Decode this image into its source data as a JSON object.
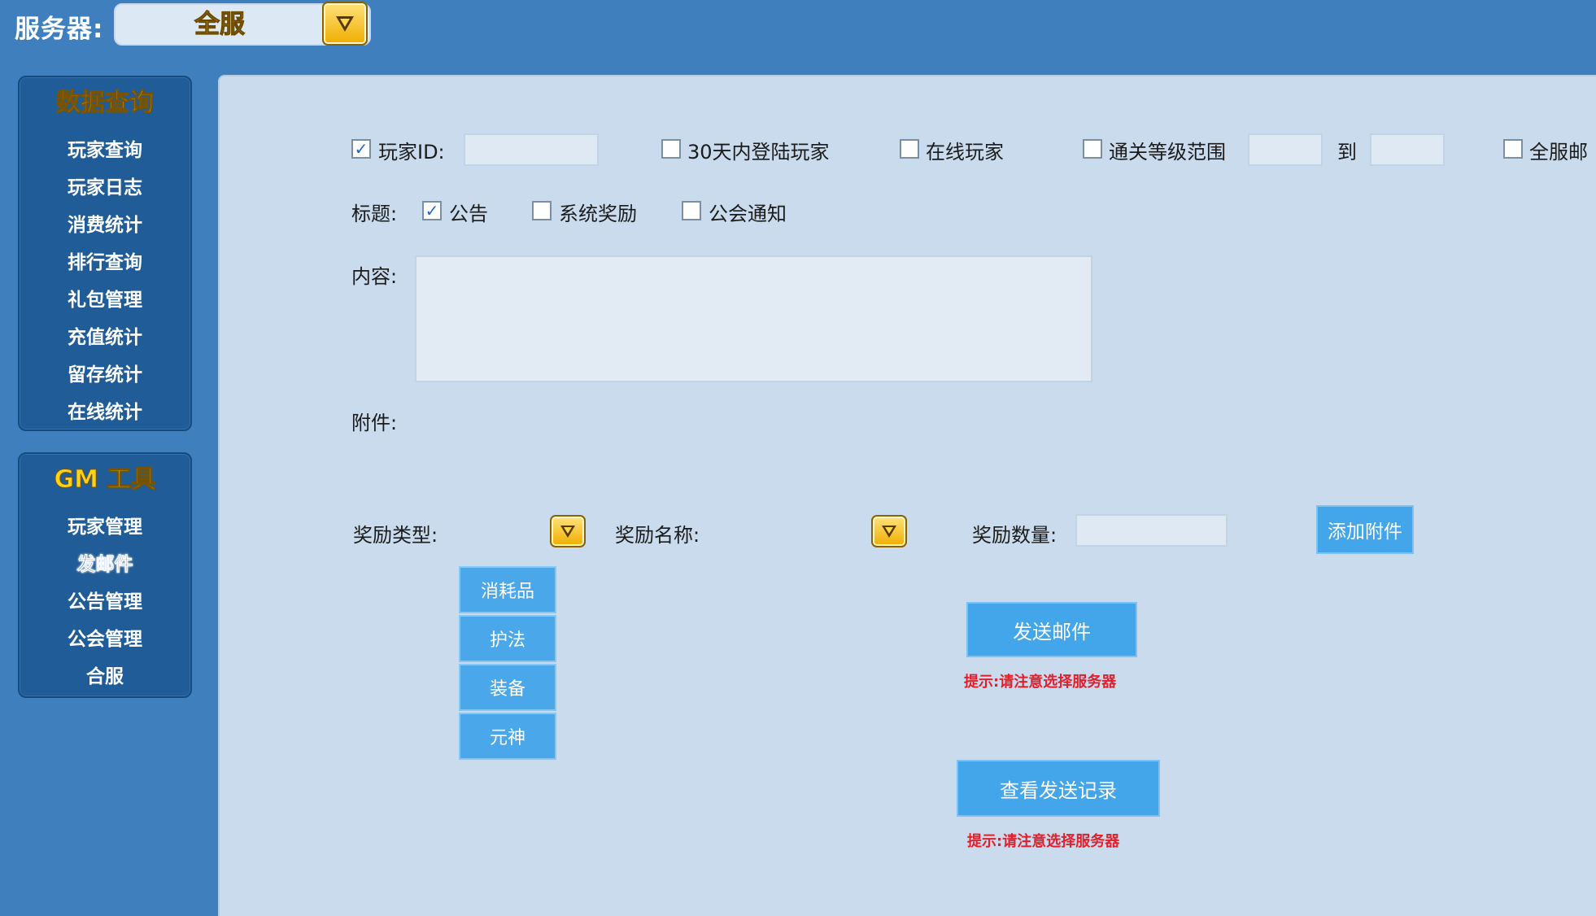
{
  "header": {
    "server_label": "服务器:",
    "server_value": "全服"
  },
  "sidebar": {
    "query_title": "数据查询",
    "query_items": [
      "玩家查询",
      "玩家日志",
      "消费统计",
      "排行查询",
      "礼包管理",
      "充值统计",
      "留存统计",
      "在线统计"
    ],
    "gm_title": "GM 工具",
    "gm_items": [
      "玩家管理",
      "发邮件",
      "公告管理",
      "公会管理",
      "合服"
    ],
    "active_item": "发邮件"
  },
  "filters": {
    "player_id_label": "玩家ID:",
    "player_id_checked": true,
    "login30_label": "30天内登陆玩家",
    "login30_checked": false,
    "online_label": "在线玩家",
    "online_checked": false,
    "level_range_label": "通关等级范围",
    "level_range_checked": false,
    "to_label": "到",
    "all_server_label": "全服邮",
    "all_server_checked": false
  },
  "title_row": {
    "label": "标题:",
    "options": [
      {
        "label": "公告",
        "checked": true
      },
      {
        "label": "系统奖励",
        "checked": false
      },
      {
        "label": "公会通知",
        "checked": false
      }
    ]
  },
  "content": {
    "label": "内容:",
    "value": ""
  },
  "attachment": {
    "label": "附件:",
    "reward_type_label": "奖励类型:",
    "reward_name_label": "奖励名称:",
    "reward_qty_label": "奖励数量:",
    "add_button": "添加附件",
    "type_options": [
      "消耗品",
      "护法",
      "装备",
      "元神"
    ]
  },
  "actions": {
    "send_button": "发送邮件",
    "send_hint": "提示:请注意选择服务器",
    "history_button": "查看发送记录",
    "history_hint": "提示:请注意选择服务器"
  }
}
